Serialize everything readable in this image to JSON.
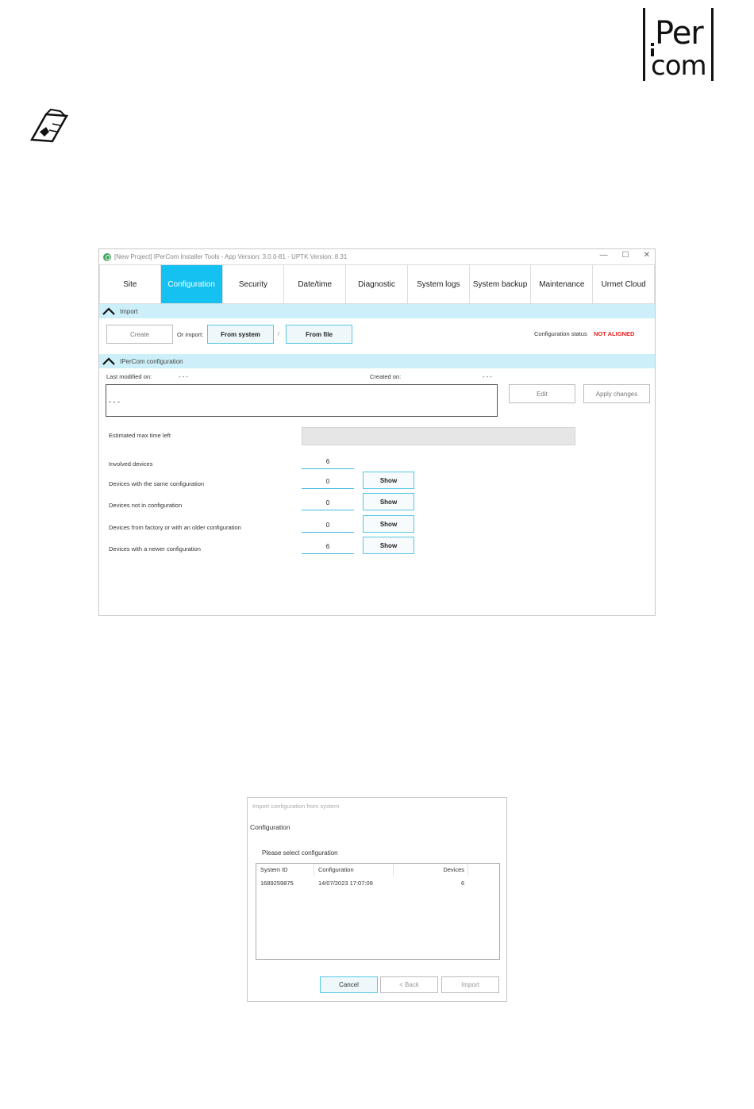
{
  "brand": {
    "logo_line1": "Per",
    "logo_line2": "com"
  },
  "window": {
    "title": "[New Project] IPerCom Installer Tools - App Version: 3.0.0-81 - UPTK Version: 8.31",
    "controls": [
      "—",
      "☐",
      "✕"
    ]
  },
  "tabs": [
    {
      "label": "Site"
    },
    {
      "label": "Configuration",
      "active": true
    },
    {
      "label": "Security"
    },
    {
      "label": "Date/time"
    },
    {
      "label": "Diagnostic"
    },
    {
      "label": "System logs"
    },
    {
      "label": "System backup"
    },
    {
      "label": "Maintenance"
    },
    {
      "label": "Urmet Cloud"
    }
  ],
  "import_section": {
    "header": "Import",
    "create_label": "Create",
    "or_import": "Or import:",
    "from_system_label": "From system",
    "slash": "/",
    "from_file_label": "From file",
    "status_label": "Configuration status",
    "status_value": "NOT ALIGNED"
  },
  "config_section": {
    "header": "IPerCom configuration",
    "last_modified_label": "Last modified on:",
    "last_modified_value": "- - -",
    "created_label": "Created on:",
    "created_value": "- - -",
    "description": "- - -",
    "edit_label": "Edit",
    "apply_label": "Apply changes",
    "estimated_label": "Estimated max time left",
    "rows": [
      {
        "label": "Involved devices",
        "value": "6",
        "show": ""
      },
      {
        "label": "Devices with the same configuration",
        "value": "0",
        "show": "Show"
      },
      {
        "label": "Devices not in configuration",
        "value": "0",
        "show": "Show"
      },
      {
        "label": "Devices from factory or with an older configuration",
        "value": "0",
        "show": "Show"
      },
      {
        "label": "Devices with a newer configuration",
        "value": "6",
        "show": "Show"
      }
    ]
  },
  "dialog": {
    "title": "Import configuration from system",
    "heading": "Configuration",
    "prompt": "Please select configuration",
    "columns": [
      "System ID",
      "Configuration",
      "Devices"
    ],
    "rows": [
      {
        "system_id": "1689259875",
        "configuration": "14/07/2023 17:07:09",
        "devices": "6"
      }
    ],
    "cancel_label": "Cancel",
    "back_label": "< Back",
    "import_label": "Import"
  },
  "colors": {
    "accent": "#15c1f0",
    "section_bg": "#cdeff9",
    "alert": "#e52020"
  }
}
